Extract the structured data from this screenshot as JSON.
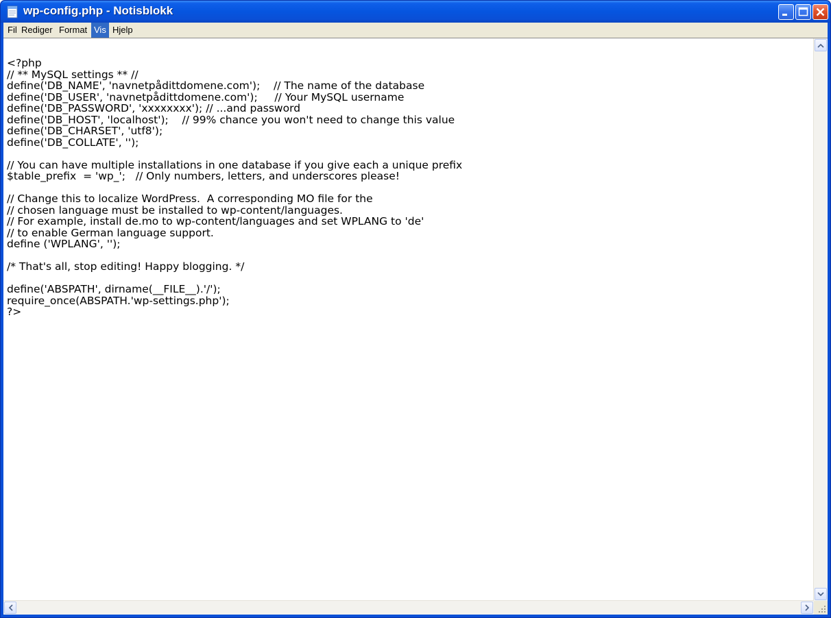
{
  "window": {
    "title": "wp-config.php - Notisblokk"
  },
  "menu": {
    "items": [
      "Fil",
      "Rediger",
      "Format",
      "Vis",
      "Hjelp"
    ],
    "active": "Vis"
  },
  "editor": {
    "content": "<?php\n// ** MySQL settings ** //\ndefine('DB_NAME', 'navnetpådittdomene.com');    // The name of the database\ndefine('DB_USER', 'navnetpådittdomene.com');     // Your MySQL username\ndefine('DB_PASSWORD', 'xxxxxxxx'); // ...and password\ndefine('DB_HOST', 'localhost');    // 99% chance you won't need to change this value\ndefine('DB_CHARSET', 'utf8');\ndefine('DB_COLLATE', '');\n\n// You can have multiple installations in one database if you give each a unique prefix\n$table_prefix  = 'wp_';   // Only numbers, letters, and underscores please!\n\n// Change this to localize WordPress.  A corresponding MO file for the\n// chosen language must be installed to wp-content/languages.\n// For example, install de.mo to wp-content/languages and set WPLANG to 'de'\n// to enable German language support.\ndefine ('WPLANG', '');\n\n/* That's all, stop editing! Happy blogging. */\n\ndefine('ABSPATH', dirname(__FILE__).'/');\nrequire_once(ABSPATH.'wp-settings.php');\n?>"
  },
  "icons": {
    "app": "notepad-icon",
    "minimize": "minimize-icon",
    "maximize": "maximize-icon",
    "close": "close-icon"
  },
  "colors": {
    "titlebar": "#0a4fd6",
    "menu_bg": "#ece9d8",
    "menu_active": "#316ac5",
    "close_button": "#e0522c"
  }
}
